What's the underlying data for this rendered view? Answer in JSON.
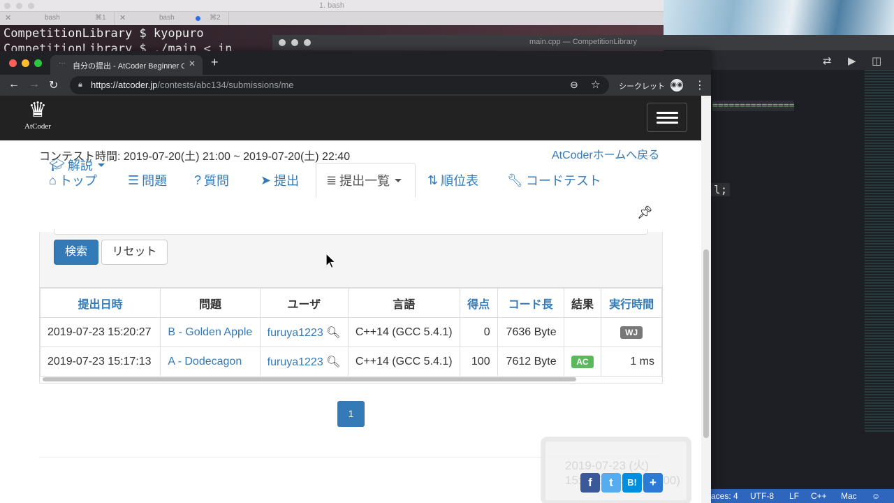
{
  "terminal": {
    "title": "1. bash",
    "tabs": [
      {
        "name": "bash",
        "shortcut": "⌘1"
      },
      {
        "name": "bash",
        "shortcut": "⌘2"
      }
    ],
    "lines": [
      "CompetitionLibrary $ kyopuro",
      "CompetitionLibrary $ ./main < in"
    ]
  },
  "editor": {
    "title": "main.cpp — CompetitionLibrary",
    "code_fragment_1": "===============",
    "code_fragment_2": "l;",
    "status": {
      "spaces": "aces: 4",
      "encoding": "UTF-8",
      "eol": "LF",
      "language": "C++",
      "platform": "Mac"
    }
  },
  "browser": {
    "tab_title": "自分の提出 - AtCoder Beginner C",
    "url_host": "https://atcoder.jp",
    "url_path": "/contests/abc134/submissions/me",
    "incognito_label": "シークレット"
  },
  "site": {
    "logo_text": "AtCoder",
    "contest_time": "コンテスト時間: 2019-07-20(土) 21:00 ~ 2019-07-20(土) 22:40",
    "home_link": "AtCoderホームへ戻る",
    "nav": [
      {
        "label": "トップ",
        "icon": "home-icon"
      },
      {
        "label": "問題",
        "icon": "tasks-icon"
      },
      {
        "label": "質問",
        "icon": "question-icon"
      },
      {
        "label": "提出",
        "icon": "send-icon"
      },
      {
        "label": "提出一覧",
        "icon": "list-icon"
      },
      {
        "label": "順位表",
        "icon": "sort-icon"
      },
      {
        "label": "コードテスト",
        "icon": "wrench-icon"
      }
    ],
    "editorial": {
      "label": "解説",
      "icon": "graduation-cap-icon"
    },
    "search_button": "検索",
    "reset_button": "リセット"
  },
  "table": {
    "headers": [
      "提出日時",
      "問題",
      "ユーザ",
      "言語",
      "得点",
      "コード長",
      "結果",
      "実行時間"
    ],
    "rows": [
      {
        "time": "2019-07-23 15:20:27",
        "task": "B - Golden Apple",
        "user": "furuya1223",
        "lang": "C++14 (GCC 5.4.1)",
        "score": "0",
        "length": "7636 Byte",
        "status": "WJ",
        "exec": ""
      },
      {
        "time": "2019-07-23 15:17:13",
        "task": "A - Dodecagon",
        "user": "furuya1223",
        "lang": "C++14 (GCC 5.4.1)",
        "score": "100",
        "length": "7612 Byte",
        "status": "AC",
        "exec": "1 ms"
      }
    ]
  },
  "pagination": {
    "current": "1"
  },
  "overlay_clock": {
    "date": "2019-07-23 (火)",
    "time": "15:22:31 JST(+09:00)"
  },
  "colors": {
    "link": "#337ab7",
    "wj": "#777777",
    "ac": "#5cb85c",
    "navbar": "#222222"
  }
}
